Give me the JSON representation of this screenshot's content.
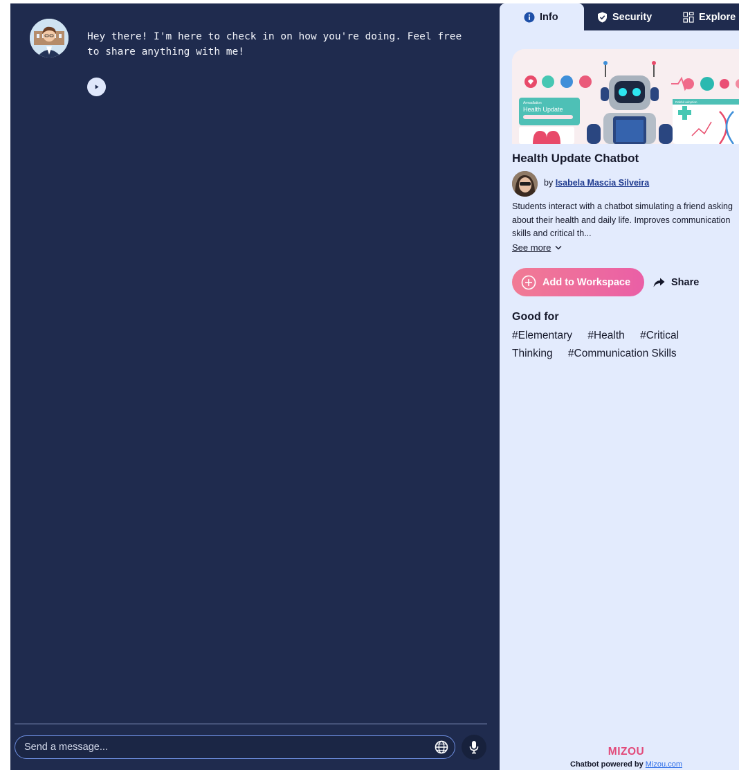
{
  "chat": {
    "bot_message": "Hey there! I'm here to check in on how you're doing. Feel free to share anything with me!",
    "input_placeholder": "Send a message..."
  },
  "info_panel": {
    "tabs": [
      {
        "label": "Info",
        "icon": "info-icon",
        "active": true
      },
      {
        "label": "Security",
        "icon": "shield-icon",
        "active": false
      },
      {
        "label": "Explore",
        "icon": "grid-icon",
        "active": false
      }
    ],
    "cover_image": {
      "banner_label": "Health Update",
      "small_caption": "Armadlation",
      "right_caption": "Rabbit adoption"
    },
    "title": "Health Update Chatbot",
    "byline_prefix": "by",
    "author": "Isabela Mascia Silveira",
    "description": "Students interact with a chatbot simulating a friend asking about their health and daily life. Improves communication skills and critical th...",
    "see_more": "See more",
    "add_button": "Add to Workspace",
    "share_button": "Share",
    "good_for_heading": "Good for",
    "tags": [
      "#Elementary",
      "#Health",
      "#Critical Thinking",
      "#Communication Skills"
    ],
    "footer": {
      "brand": "MIZOU",
      "powered_prefix": "Chatbot powered by",
      "powered_link": "Mizou.com"
    }
  },
  "colors": {
    "chat_bg": "#1f2b4e",
    "panel_bg": "#e3ebfd",
    "accent_pink": "#ea5fa6",
    "link_blue": "#1e3a8f"
  }
}
